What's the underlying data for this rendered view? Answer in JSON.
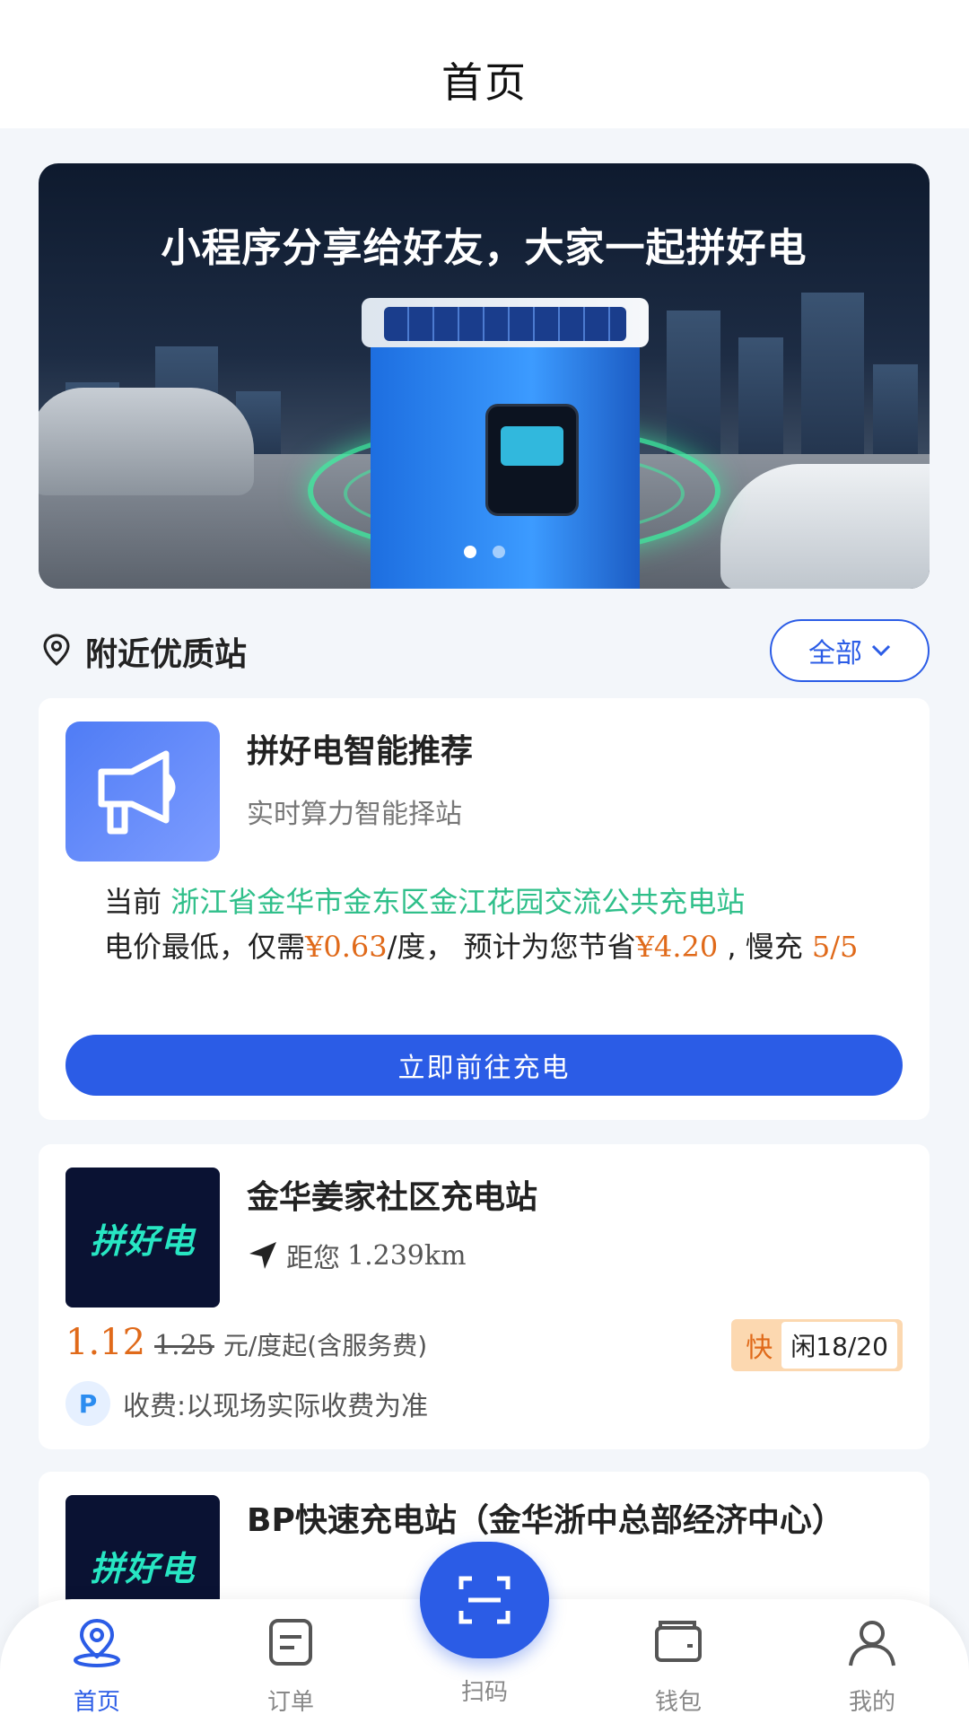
{
  "header": {
    "title": "首页"
  },
  "banner": {
    "headline": "小程序分享给好友，大家一起拼好电",
    "slide_count": 2,
    "active_slide": 1
  },
  "nearby": {
    "label": "附近优质站",
    "filter_label": "全部"
  },
  "recommend": {
    "title": "拼好电智能推荐",
    "subtitle": "实时算力智能择站",
    "prefix": "当前 ",
    "station": "浙江省金华市金东区金江花园交流公共充电站",
    "line2a": "电价最低，仅需",
    "price": "¥0.63",
    "line2b": "/度， 预计为您节省",
    "saving": "¥4.20",
    "line2c": " , 慢充 ",
    "slots": "5/5",
    "button": "立即前往充电"
  },
  "stations": [
    {
      "logo": "拼好电",
      "name": "金华姜家社区充电站",
      "distance_prefix": "距您",
      "distance": "1.239km",
      "price_now": "1.12",
      "price_old": "1.25",
      "price_unit": "元/度起(含服务费)",
      "tag_fast": "快",
      "tag_idle": "闲18/20",
      "fee_badge": "P",
      "fee_text": "收费:以现场实际收费为准"
    },
    {
      "logo": "拼好电",
      "name": "BP快速充电站（金华浙中总部经济中心）"
    }
  ],
  "tabbar": {
    "home": "首页",
    "orders": "订单",
    "scan": "扫码",
    "wallet": "钱包",
    "mine": "我的"
  },
  "colors": {
    "accent": "#2b5ce6",
    "price": "#e06a1a",
    "station_link": "#2fbf8a"
  }
}
